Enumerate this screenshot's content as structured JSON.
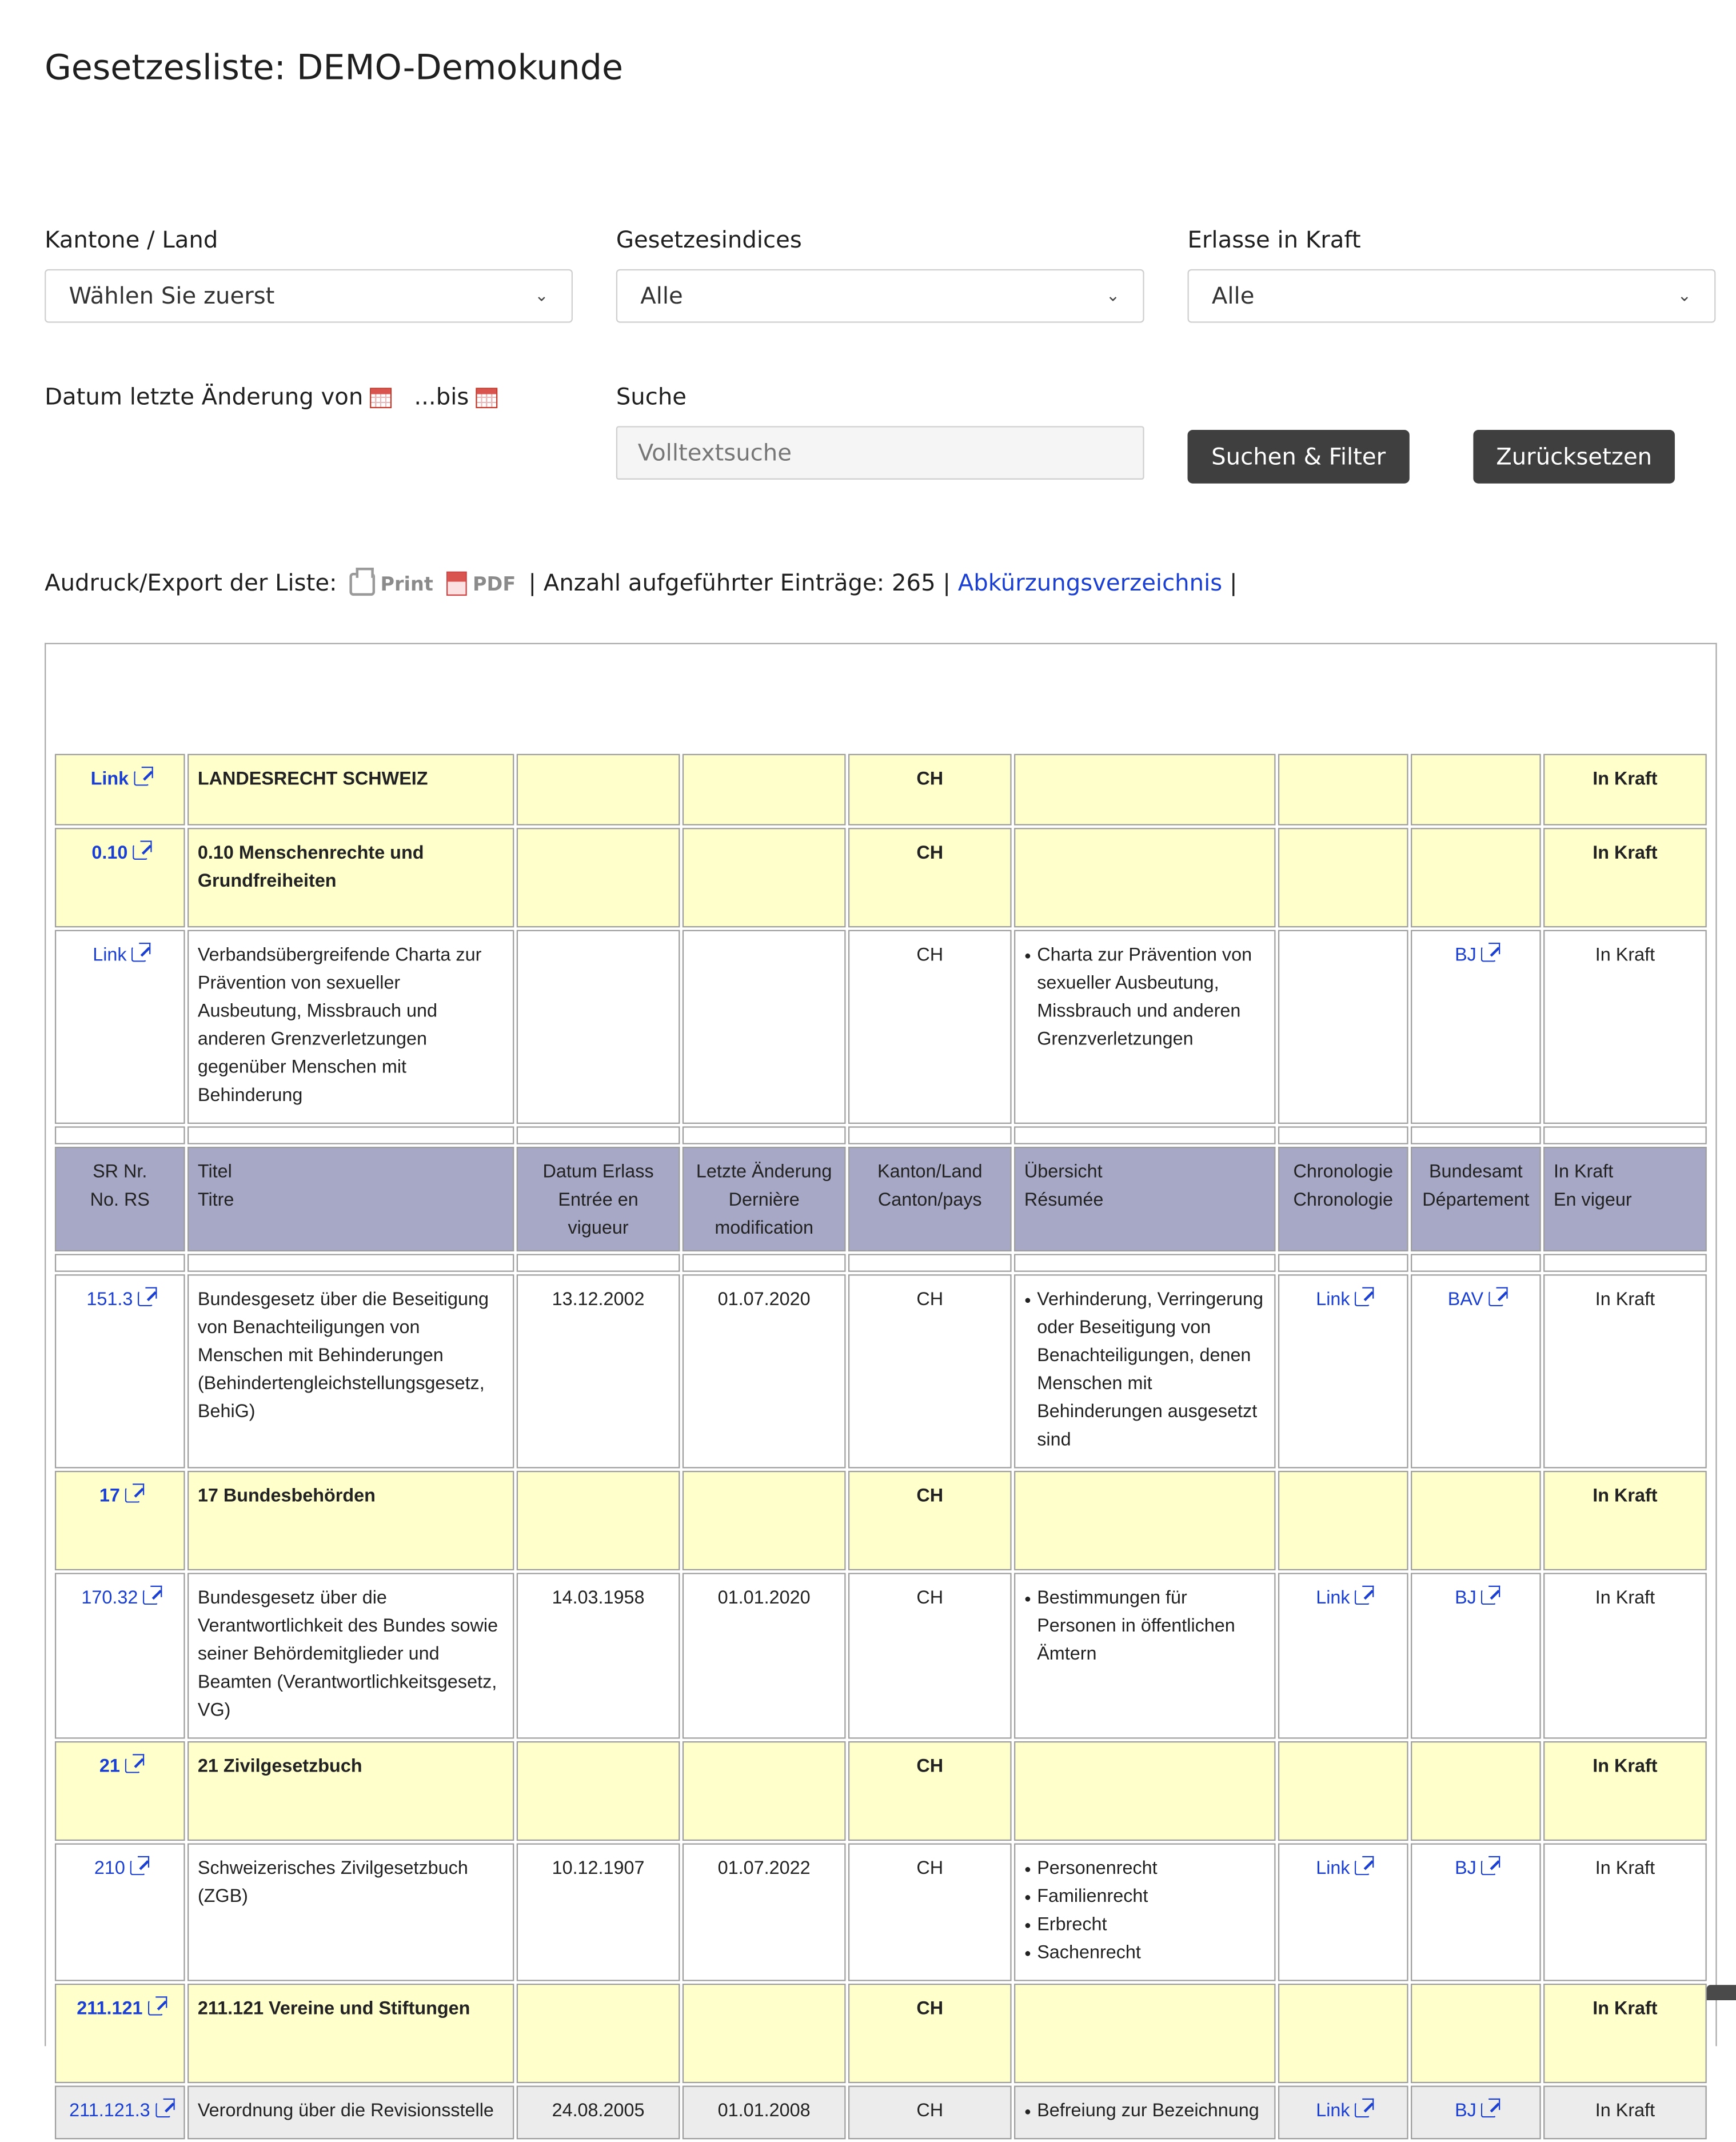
{
  "page": {
    "title": "Gesetzesliste: DEMO-Demokunde"
  },
  "filters": {
    "kanton_label": "Kantone / Land",
    "kanton_value": "Wählen Sie zuerst",
    "index_label": "Gesetzesindices",
    "index_value": "Alle",
    "inkraft_label": "Erlasse in Kraft",
    "inkraft_value": "Alle",
    "date_label_from": "Datum letzte Änderung von",
    "date_label_to": "...bis",
    "search_label": "Suche",
    "search_placeholder": "Volltextsuche",
    "search_button": "Suchen & Filter",
    "reset_button": "Zurücksetzen"
  },
  "export": {
    "label": "Audruck/Export der Liste:",
    "print": "Print",
    "pdf": "PDF",
    "count_text": "| Anzahl aufgeführter Einträge: 265 |",
    "abbrev_link": "Abkürzungsverzeichnis",
    "trailing": "|"
  },
  "table": {
    "header": {
      "sr": [
        "SR Nr.",
        "No. RS"
      ],
      "titel": [
        "Titel",
        "Titre"
      ],
      "erlass": "Datum Erlass Entrée en vigueur",
      "aenderung": "Letzte Änderung Dernière modification",
      "kanton": [
        "Kanton/Land",
        "Canton/pays"
      ],
      "uebersicht": [
        "Übersicht",
        "Résumée"
      ],
      "chrono": [
        "Chronologie",
        "Chronologie"
      ],
      "amt": [
        "Bundesamt",
        "Département"
      ],
      "inkraft": [
        "In Kraft",
        "En vigeur"
      ]
    },
    "rows": [
      {
        "type": "sec",
        "sr": "Link",
        "title": "LANDESRECHT SCHWEIZ",
        "kanton": "CH",
        "status": "In Kraft"
      },
      {
        "type": "sec",
        "sr": "0.10",
        "title": "0.10 Menschenrechte und Grundfreiheiten",
        "kanton": "CH",
        "status": "In Kraft"
      },
      {
        "type": "item",
        "sr": "Link",
        "title": "Verbandsübergreifende Charta zur Prävention von sexueller Ausbeutung, Missbrauch und anderen Grenzverletzungen gegenüber Menschen mit Behinderung",
        "erlass": "",
        "aenderung": "",
        "kanton": "CH",
        "summary": [
          "Charta zur Prävention von sexueller Ausbeutung, Missbrauch und anderen Grenzverletzungen"
        ],
        "chrono": "",
        "amt": "BJ",
        "status": "In Kraft"
      },
      {
        "type": "item",
        "sr": "151.3",
        "title": "Bundesgesetz über die Beseitigung von Benachteiligungen von Menschen mit Behinderungen (Behindertengleichstellungsgesetz, BehiG)",
        "erlass": "13.12.2002",
        "aenderung": "01.07.2020",
        "kanton": "CH",
        "summary": [
          "Verhinderung, Verringerung oder Beseitigung von Benachteiligungen, denen Menschen mit Behinderungen ausgesetzt sind"
        ],
        "chrono": "Link",
        "amt": "BAV",
        "status": "In Kraft"
      },
      {
        "type": "sec",
        "sr": "17",
        "title": "17 Bundesbehörden",
        "kanton": "CH",
        "status": "In Kraft"
      },
      {
        "type": "item",
        "sr": "170.32",
        "title": "Bundesgesetz über die Verantwortlichkeit des Bundes sowie seiner Behördemitglieder und Beamten (Verantwortlichkeitsgesetz, VG)",
        "erlass": "14.03.1958",
        "aenderung": "01.01.2020",
        "kanton": "CH",
        "summary": [
          "Bestimmungen für Personen in öffentlichen Ämtern"
        ],
        "chrono": "Link",
        "amt": "BJ",
        "status": "In Kraft"
      },
      {
        "type": "sec",
        "sr": "21",
        "title": "21 Zivilgesetzbuch",
        "kanton": "CH",
        "status": "In Kraft"
      },
      {
        "type": "item",
        "sr": "210",
        "title": "Schweizerisches Zivilgesetzbuch (ZGB)",
        "erlass": "10.12.1907",
        "aenderung": "01.07.2022",
        "kanton": "CH",
        "summary": [
          "Personenrecht",
          "Familienrecht",
          "Erbrecht",
          "Sachenrecht"
        ],
        "chrono": "Link",
        "amt": "BJ",
        "status": "In Kraft"
      },
      {
        "type": "sec",
        "sr": "211.121",
        "title": "211.121 Vereine und Stiftungen",
        "kanton": "CH",
        "status": "In Kraft"
      },
      {
        "type": "item",
        "grey": true,
        "sr": "211.121.3",
        "title": "Verordnung über die Revisionsstelle",
        "erlass": "24.08.2005",
        "aenderung": "01.01.2008",
        "kanton": "CH",
        "summary": [
          "Befreiung zur Bezeichnung"
        ],
        "chrono": "Link",
        "amt": "BJ",
        "status": "In Kraft"
      }
    ]
  }
}
